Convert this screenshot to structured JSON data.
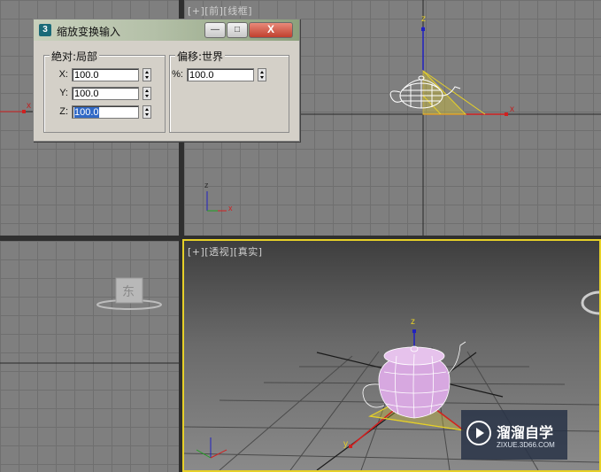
{
  "viewports": {
    "top_right_label": [
      "+",
      "前",
      "线框"
    ],
    "bottom_right_label": [
      "+",
      "透视",
      "真实"
    ],
    "bottom_left_cube_label": "东",
    "axis_labels": {
      "x": "x",
      "y": "y",
      "z": "z"
    }
  },
  "dialog": {
    "title": "缩放变换输入",
    "minimize_label": "—",
    "maximize_label": "□",
    "close_label": "X",
    "absolute_group": {
      "title": "絶对:局部",
      "fields": [
        {
          "label": "X:",
          "value": "100.0",
          "selected": false
        },
        {
          "label": "Y:",
          "value": "100.0",
          "selected": false
        },
        {
          "label": "Z:",
          "value": "100.0",
          "selected": true
        }
      ]
    },
    "offset_group": {
      "title": "偏移:世界",
      "fields": [
        {
          "label": "%:",
          "value": "100.0"
        }
      ]
    }
  },
  "watermark": {
    "title": "溜溜自学",
    "url": "ZIXUE.3D66.COM"
  },
  "colors": {
    "active_border": "#e6d028",
    "teapot_wire": "#ffffff",
    "teapot_fill": "#d7a8e0",
    "gizmo": "#e6d028",
    "axis_red": "#d02020",
    "axis_blue": "#2020c0",
    "axis_green": "#20a020"
  }
}
